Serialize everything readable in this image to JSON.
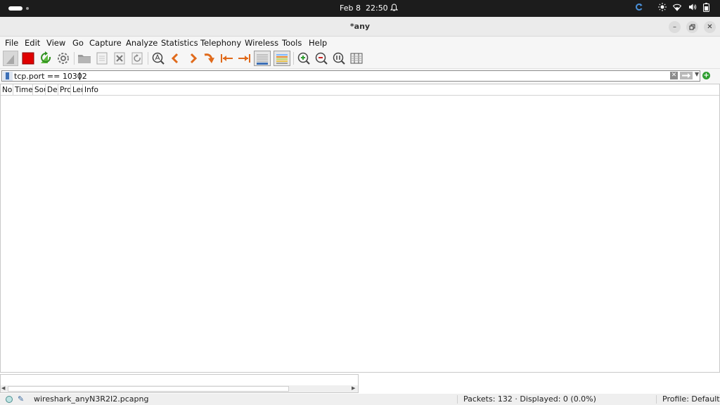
{
  "system_bar": {
    "date": "Feb 8",
    "time": "22:50",
    "icons": [
      "activities-pill",
      "workspace-dot",
      "notification-bell-icon",
      "update-icon",
      "brightness-icon",
      "wifi-icon",
      "volume-icon",
      "battery-icon"
    ]
  },
  "window": {
    "title": "*any",
    "buttons": [
      "minimize",
      "restore",
      "close"
    ]
  },
  "menu": [
    {
      "label": "File"
    },
    {
      "label": "Edit"
    },
    {
      "label": "View"
    },
    {
      "label": "Go"
    },
    {
      "label": "Capture"
    },
    {
      "label": "Analyze"
    },
    {
      "label": "Statistics"
    },
    {
      "label": "Telephony"
    },
    {
      "label": "Wireless"
    },
    {
      "label": "Tools"
    },
    {
      "label": "Help"
    }
  ],
  "toolbar": {
    "buttons": [
      "start-capture",
      "stop-capture",
      "restart-capture",
      "capture-options",
      "open-file",
      "save-file",
      "close-file",
      "reload-file",
      "find-packet",
      "go-back",
      "go-forward",
      "go-to-packet",
      "go-first",
      "go-last",
      "auto-scroll",
      "colorize",
      "zoom-in",
      "zoom-out",
      "zoom-normal",
      "resize-columns"
    ]
  },
  "filter": {
    "value": "tcp.port == 10302"
  },
  "packet_list": {
    "columns": [
      "No",
      "Time",
      "Sou",
      "De",
      "Prc",
      "Ler",
      "Info"
    ],
    "rows": []
  },
  "status": {
    "file": "wireshark_anyN3R2I2.pcapng",
    "packets": "Packets: 132 · Displayed: 0 (0.0%)",
    "profile": "Profile: Default"
  },
  "colors": {
    "stop_red": "#e00000",
    "arrow_orange": "#e06a1b",
    "zoom_green": "#2f9e31",
    "topbar": "#1c1c1c"
  }
}
